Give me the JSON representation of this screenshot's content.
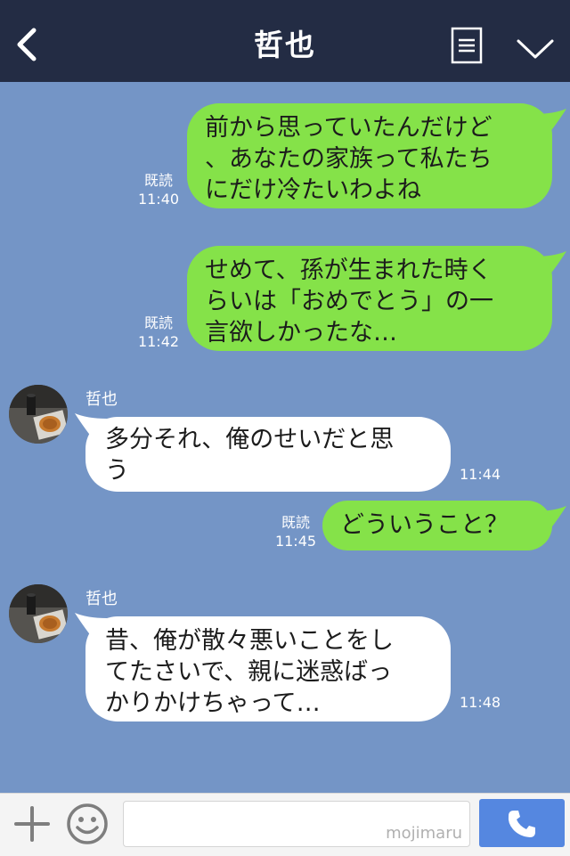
{
  "header": {
    "title": "哲也",
    "back_icon": "back-chevron-icon",
    "menu_icon": "list-menu-icon",
    "expand_icon": "chevron-down-icon"
  },
  "messages": [
    {
      "direction": "out",
      "lines": [
        "前から思っていたんだけど",
        "、あなたの家族って私たち",
        "にだけ冷たいわよね"
      ],
      "read": "既読",
      "time": "11:40"
    },
    {
      "direction": "out",
      "lines": [
        "せめて、孫が生まれた時く",
        "らいは「おめでとう」の一",
        "言欲しかったな…"
      ],
      "read": "既読",
      "time": "11:42"
    },
    {
      "direction": "in",
      "sender": "哲也",
      "lines": [
        "多分それ、俺のせいだと思",
        "う"
      ],
      "time": "11:44"
    },
    {
      "direction": "out",
      "lines": [
        "どういうこと？"
      ],
      "read": "既読",
      "time": "11:45"
    },
    {
      "direction": "in",
      "sender": "哲也",
      "lines": [
        "昔、俺が散々悪いことをし",
        "てたさいで、親に迷惑ばっ",
        "かりかけちゃって…"
      ],
      "time": "11:48"
    }
  ],
  "footer": {
    "input_value": "",
    "watermark": "mojimaru",
    "plus_icon": "plus-icon",
    "emoji_icon": "smile-icon",
    "call_icon": "phone-icon"
  },
  "colors": {
    "header_bg": "#232c44",
    "chat_bg": "#7495c6",
    "outgoing_bubble": "#85e249",
    "incoming_bubble": "#ffffff",
    "call_button": "#5587e0"
  }
}
